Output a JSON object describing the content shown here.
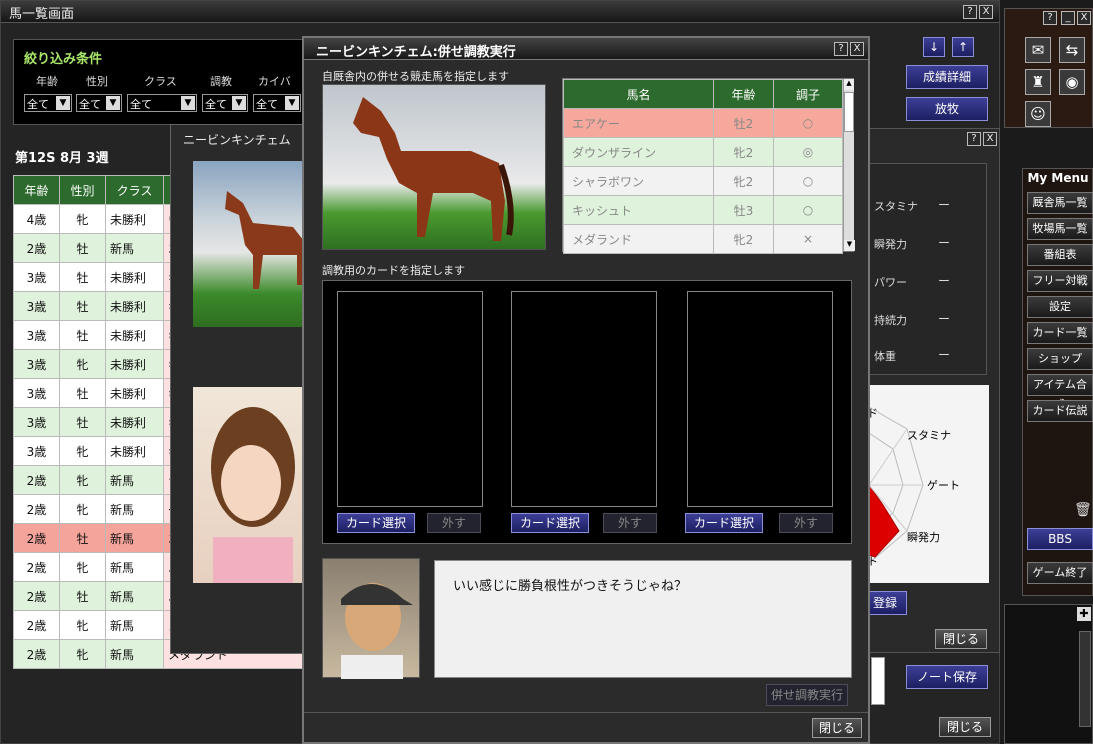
{
  "bg": {
    "title": "馬一覧画面",
    "filter_title": "絞り込み条件",
    "filters": [
      {
        "label": "年齢",
        "value": "全て"
      },
      {
        "label": "性別",
        "value": "全て"
      },
      {
        "label": "クラス",
        "value": "全て"
      },
      {
        "label": "調教",
        "value": "全て"
      },
      {
        "label": "カイバ",
        "value": "全て"
      }
    ],
    "season": "第12S 8月 3週",
    "columns": [
      "年齢",
      "性別",
      "クラス"
    ],
    "rows": [
      {
        "age": "4歳",
        "sex": "牝",
        "cls": "未勝利",
        "extra": "ウ",
        "hl": false
      },
      {
        "age": "2歳",
        "sex": "牡",
        "cls": "新馬",
        "extra": "エ",
        "hl": false
      },
      {
        "age": "3歳",
        "sex": "牡",
        "cls": "未勝利",
        "extra": "キ",
        "hl": false
      },
      {
        "age": "3歳",
        "sex": "牡",
        "cls": "未勝利",
        "extra": "キ",
        "hl": false
      },
      {
        "age": "3歳",
        "sex": "牡",
        "cls": "未勝利",
        "extra": "キ",
        "hl": false
      },
      {
        "age": "3歳",
        "sex": "牝",
        "cls": "未勝利",
        "extra": "キ",
        "hl": false
      },
      {
        "age": "3歳",
        "sex": "牡",
        "cls": "未勝利",
        "extra": "キ",
        "hl": false
      },
      {
        "age": "3歳",
        "sex": "牡",
        "cls": "未勝利",
        "extra": "キ",
        "hl": false
      },
      {
        "age": "3歳",
        "sex": "牝",
        "cls": "未勝利",
        "extra": "キ",
        "hl": false
      },
      {
        "age": "2歳",
        "sex": "牝",
        "cls": "新馬",
        "extra": "シ",
        "hl": false
      },
      {
        "age": "2歳",
        "sex": "牝",
        "cls": "新馬",
        "extra": "ダ",
        "hl": false
      },
      {
        "age": "2歳",
        "sex": "牡",
        "cls": "新馬",
        "extra": "エ",
        "hl": true
      },
      {
        "age": "2歳",
        "sex": "牝",
        "cls": "新馬",
        "extra": "ニ",
        "hl": false
      },
      {
        "age": "2歳",
        "sex": "牡",
        "cls": "新馬",
        "extra": "ニ",
        "hl": false
      },
      {
        "age": "2歳",
        "sex": "牝",
        "cls": "新馬",
        "extra": "メ",
        "hl": false
      },
      {
        "age": "2歳",
        "sex": "牝",
        "cls": "新馬",
        "extra": "メダランド",
        "hl": false
      }
    ],
    "btn_detail": "成績詳細",
    "btn_release": "放牧",
    "btn_note": "ノート保存",
    "btn_close": "閉じる"
  },
  "right": {
    "stats": [
      "スタミナ",
      "瞬発力",
      "パワー",
      "持続力",
      "体重"
    ],
    "stat_value": "ー",
    "radar": [
      "ド",
      "スタミナ",
      "ゲート",
      "瞬発力",
      "ト"
    ],
    "btn_register": "登録",
    "btn_close": "閉じる"
  },
  "menu": {
    "title": "My Menu",
    "items": [
      "厩舎馬一覧",
      "牧場馬一覧",
      "番組表",
      "フリー対戦",
      "設定",
      "カード一覧",
      "ショップ",
      "アイテム合成",
      "カード伝説"
    ],
    "bbs": "BBS",
    "quit": "ゲーム終了"
  },
  "mid": {
    "title": "ニービンキンチェム"
  },
  "dialog": {
    "title": "ニービンキンチェム:併せ調教実行",
    "prompt_horse": "自厩舎内の併せる競走馬を指定します",
    "horse_cols": [
      "馬名",
      "年齢",
      "調子"
    ],
    "horses": [
      {
        "name": "エアケー",
        "age": "牡2",
        "cond": "○",
        "sel": true
      },
      {
        "name": "ダウンザライン",
        "age": "牝2",
        "cond": "◎",
        "sel": false
      },
      {
        "name": "シャラボワン",
        "age": "牝2",
        "cond": "○",
        "sel": false
      },
      {
        "name": "キッシュト",
        "age": "牡3",
        "cond": "○",
        "sel": false
      },
      {
        "name": "メダランド",
        "age": "牝2",
        "cond": "×",
        "sel": false
      }
    ],
    "prompt_card": "調教用のカードを指定します",
    "card_select": "カード選択",
    "card_remove": "外す",
    "speech": "いい感じに勝負根性がつきそうじゃね？",
    "btn_execute": "併せ調教実行",
    "btn_close": "閉じる"
  },
  "help_label": "?",
  "close_label": "X",
  "min_label": "_"
}
